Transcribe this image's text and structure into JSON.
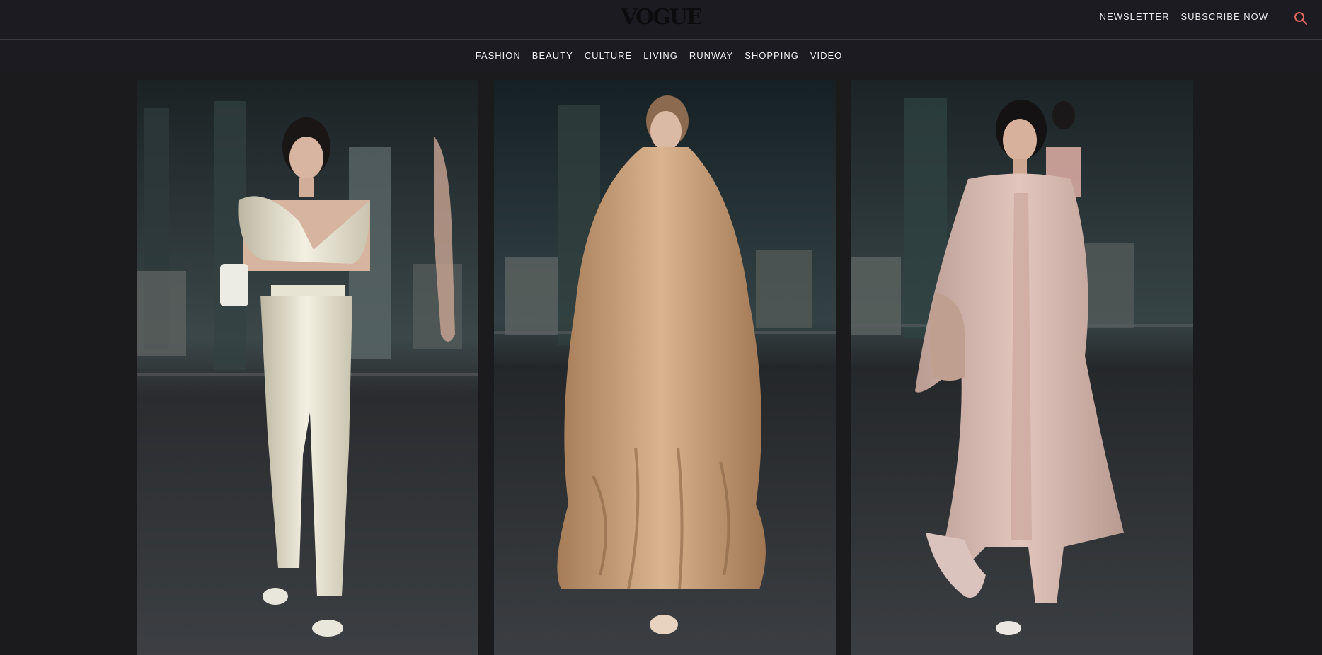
{
  "header": {
    "logo": "VOGUE",
    "links": [
      "NEWSLETTER",
      "SUBSCRIBE NOW"
    ],
    "search_icon": "search-icon",
    "accent": "#e0665a"
  },
  "nav": {
    "items": [
      "FASHION",
      "BEAUTY",
      "CULTURE",
      "LIVING",
      "RUNWAY",
      "SHOPPING",
      "VIDEO"
    ]
  },
  "gallery": {
    "images": [
      {
        "name": "runway-look-ivory-satin",
        "palette": {
          "bg": "#2f3a3d",
          "floor": "#3a3d40",
          "garment": "#e9e6d6",
          "skin": "#d9b7a3"
        }
      },
      {
        "name": "runway-look-camel-fur",
        "palette": {
          "bg": "#2a3538",
          "floor": "#3b3e42",
          "garment": "#caa07a",
          "skin": "#d9b7a3"
        }
      },
      {
        "name": "runway-look-blush-coat",
        "palette": {
          "bg": "#2e393c",
          "floor": "#3a3d41",
          "garment": "#d7b7ae",
          "skin": "#d8b29b"
        }
      }
    ]
  }
}
